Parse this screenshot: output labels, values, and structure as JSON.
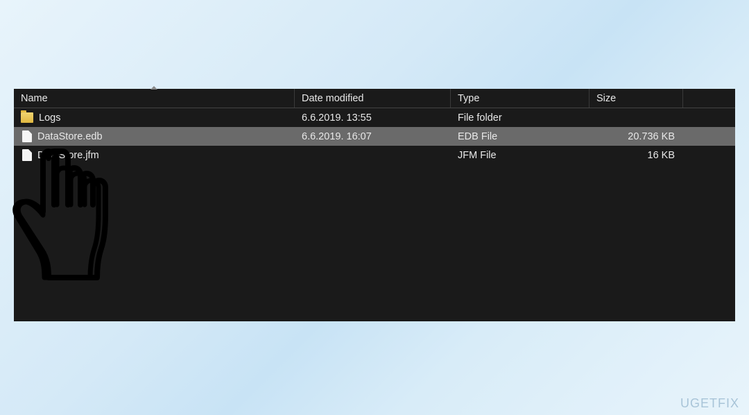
{
  "columns": {
    "name": "Name",
    "date": "Date modified",
    "type": "Type",
    "size": "Size"
  },
  "rows": [
    {
      "icon": "folder",
      "name": "Logs",
      "date": "6.6.2019. 13:55",
      "type": "File folder",
      "size": "",
      "selected": false
    },
    {
      "icon": "file",
      "name": "DataStore.edb",
      "date": "6.6.2019. 16:07",
      "type": "EDB File",
      "size": "20.736 KB",
      "selected": true
    },
    {
      "icon": "file",
      "name": "DataStore.jfm",
      "date": "",
      "type": "JFM File",
      "size": "16 KB",
      "selected": false
    }
  ],
  "watermark": "UGETFIX"
}
